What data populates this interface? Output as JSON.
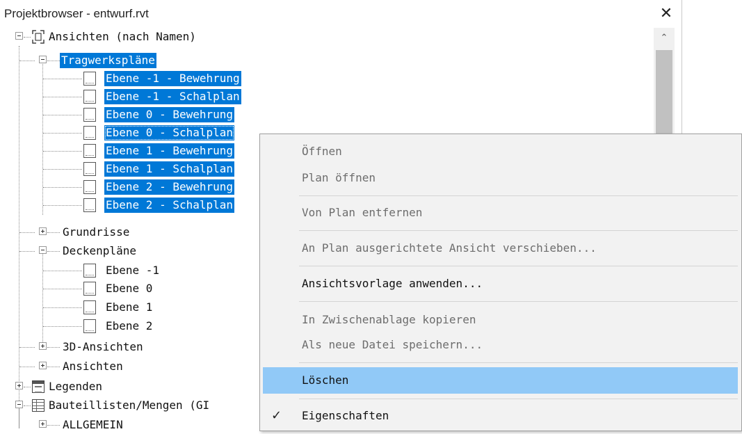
{
  "window": {
    "title": "Projektbrowser - entwurf.rvt",
    "close_glyph": "✕"
  },
  "scrollbar": {
    "up_glyph": "⌃"
  },
  "tree": {
    "root": {
      "label": "Ansichten (nach Namen)",
      "icon": "views-icon",
      "expanded": true
    },
    "tragwerksplaene": {
      "label": "Tragwerkspläne",
      "selected": true,
      "items": [
        {
          "label": "Ebene -1 - Bewehrung",
          "selected": true
        },
        {
          "label": "Ebene -1 - Schalplan",
          "selected": true
        },
        {
          "label": "Ebene 0 - Bewehrung",
          "selected": true
        },
        {
          "label": "Ebene 0 - Schalplan",
          "selected": true,
          "focused": true
        },
        {
          "label": "Ebene 1 - Bewehrung",
          "selected": true
        },
        {
          "label": "Ebene 1 - Schalplan",
          "selected": true
        },
        {
          "label": "Ebene 2 - Bewehrung",
          "selected": true
        },
        {
          "label": "Ebene 2 - Schalplan",
          "selected": true
        }
      ]
    },
    "grundrisse": {
      "label": "Grundrisse",
      "expanded": false
    },
    "deckenplaene": {
      "label": "Deckenpläne",
      "expanded": true,
      "items": [
        {
          "label": "Ebene -1"
        },
        {
          "label": "Ebene 0"
        },
        {
          "label": "Ebene 1"
        },
        {
          "label": "Ebene 2"
        }
      ]
    },
    "ansichten_3d": {
      "label": "3D-Ansichten",
      "expanded": false
    },
    "ansichten": {
      "label": "Ansichten",
      "expanded": false
    },
    "legenden": {
      "label": "Legenden",
      "icon": "legend-icon",
      "expanded": false
    },
    "bauteillisten": {
      "label": "Bauteillisten/Mengen (GI",
      "icon": "schedule-icon",
      "expanded": true
    },
    "allgemein": {
      "label": "ALLGEMEIN",
      "expanded": false
    }
  },
  "context_menu": {
    "items": [
      {
        "label": "Öffnen",
        "enabled": false
      },
      {
        "label": "Plan öffnen",
        "enabled": false
      },
      {
        "label": "Von Plan entfernen",
        "enabled": false
      },
      {
        "label": "An Plan ausgerichtete Ansicht verschieben...",
        "enabled": false
      },
      {
        "label": "Ansichtsvorlage anwenden...",
        "enabled": true
      },
      {
        "label": "In Zwischenablage kopieren",
        "enabled": false
      },
      {
        "label": "Als neue Datei speichern...",
        "enabled": false
      },
      {
        "label": "Löschen",
        "enabled": true,
        "highlighted": true
      },
      {
        "label": "Eigenschaften",
        "enabled": true,
        "checked": true
      }
    ],
    "check_glyph": "✓"
  },
  "colors": {
    "selection": "#0078d7",
    "menu_highlight": "#91c9f7",
    "menu_bg": "#f2f2f2"
  }
}
